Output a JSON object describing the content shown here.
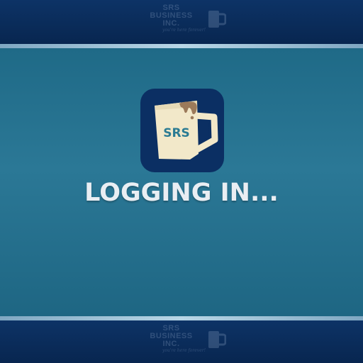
{
  "brand": {
    "line1": "SRS",
    "line2": "BUSINESS",
    "line3": "INC.",
    "tagline": "you're here forever!",
    "icon": "mug-icon",
    "mug_label": "SRS"
  },
  "status": {
    "text": "LOGGING IN..."
  },
  "colors": {
    "bar": "#0b2f5f",
    "background": "#28758f",
    "stripe": "#a9c9d8",
    "icon_bg": "#0b2f63",
    "mug": "#f2e8c9",
    "mug_text": "#2a7b93",
    "coffee_drip": "#9c7a5a",
    "status_text": "#e9eef3"
  }
}
